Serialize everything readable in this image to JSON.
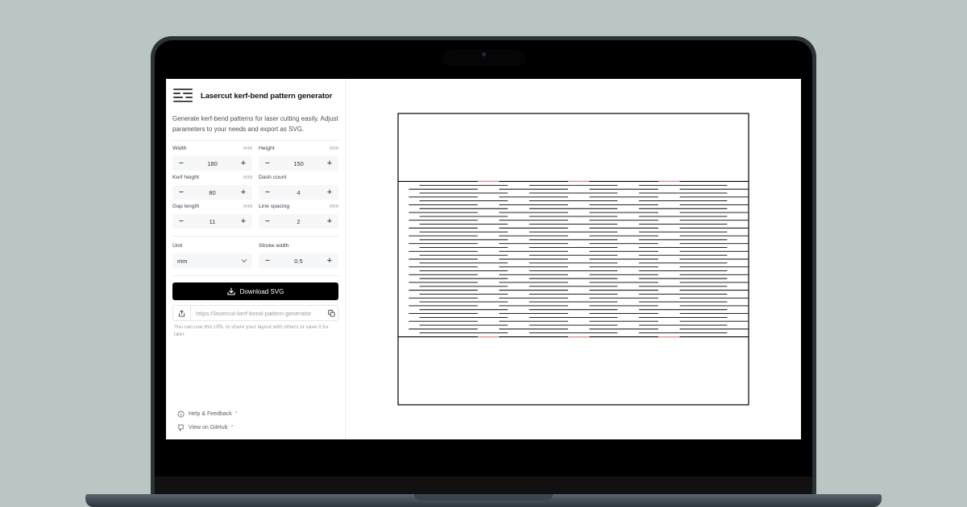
{
  "app": {
    "title": "Lasercut kerf-bend pattern generator",
    "description": "Generate kerf-bend patterns for laser cutting easily. Adjust parameters to your needs and export as SVG."
  },
  "fields": {
    "width": {
      "label": "Width",
      "unit": "mm",
      "value": "180"
    },
    "height": {
      "label": "Height",
      "unit": "mm",
      "value": "150"
    },
    "kerf_height": {
      "label": "Kerf height",
      "unit": "mm",
      "value": "80"
    },
    "dash_count": {
      "label": "Dash count",
      "value": "4"
    },
    "gap_length": {
      "label": "Gap length",
      "unit": "mm",
      "value": "11"
    },
    "line_spacing": {
      "label": "Line spacing",
      "unit": "mm",
      "value": "2"
    },
    "unit": {
      "label": "Unit",
      "value": "mm"
    },
    "stroke_width": {
      "label": "Stroke width",
      "value": "0.5"
    }
  },
  "stepper": {
    "minus": "−",
    "plus": "+"
  },
  "actions": {
    "download_label": "Download SVG",
    "share_url": "https://lasercut-kerf-bend-pattern-generator",
    "share_hint": "You can use this URL to share your layout with others or save it for later."
  },
  "footer": {
    "help_label": "Help & Feedback",
    "github_label": "View on GitHub",
    "external_mark": "↗"
  },
  "icons": {
    "logo": "kerf-pattern-logo-icon",
    "download": "download-icon",
    "share": "share-icon",
    "copy": "copy-icon",
    "help": "info-circle-icon",
    "github": "github-icon",
    "chevron": "chevron-down-icon"
  },
  "colors": {
    "primary_button": "#000000",
    "pattern_line": "#000000",
    "gap_marker": "#e58a8a",
    "laptop_background": "#b9c6c3"
  },
  "pattern": {
    "width": 180,
    "height": 150,
    "kerf_height": 80,
    "dash_count": 4,
    "gap_length": 11,
    "line_spacing": 2,
    "stroke_width": 0.5,
    "unit": "mm"
  }
}
